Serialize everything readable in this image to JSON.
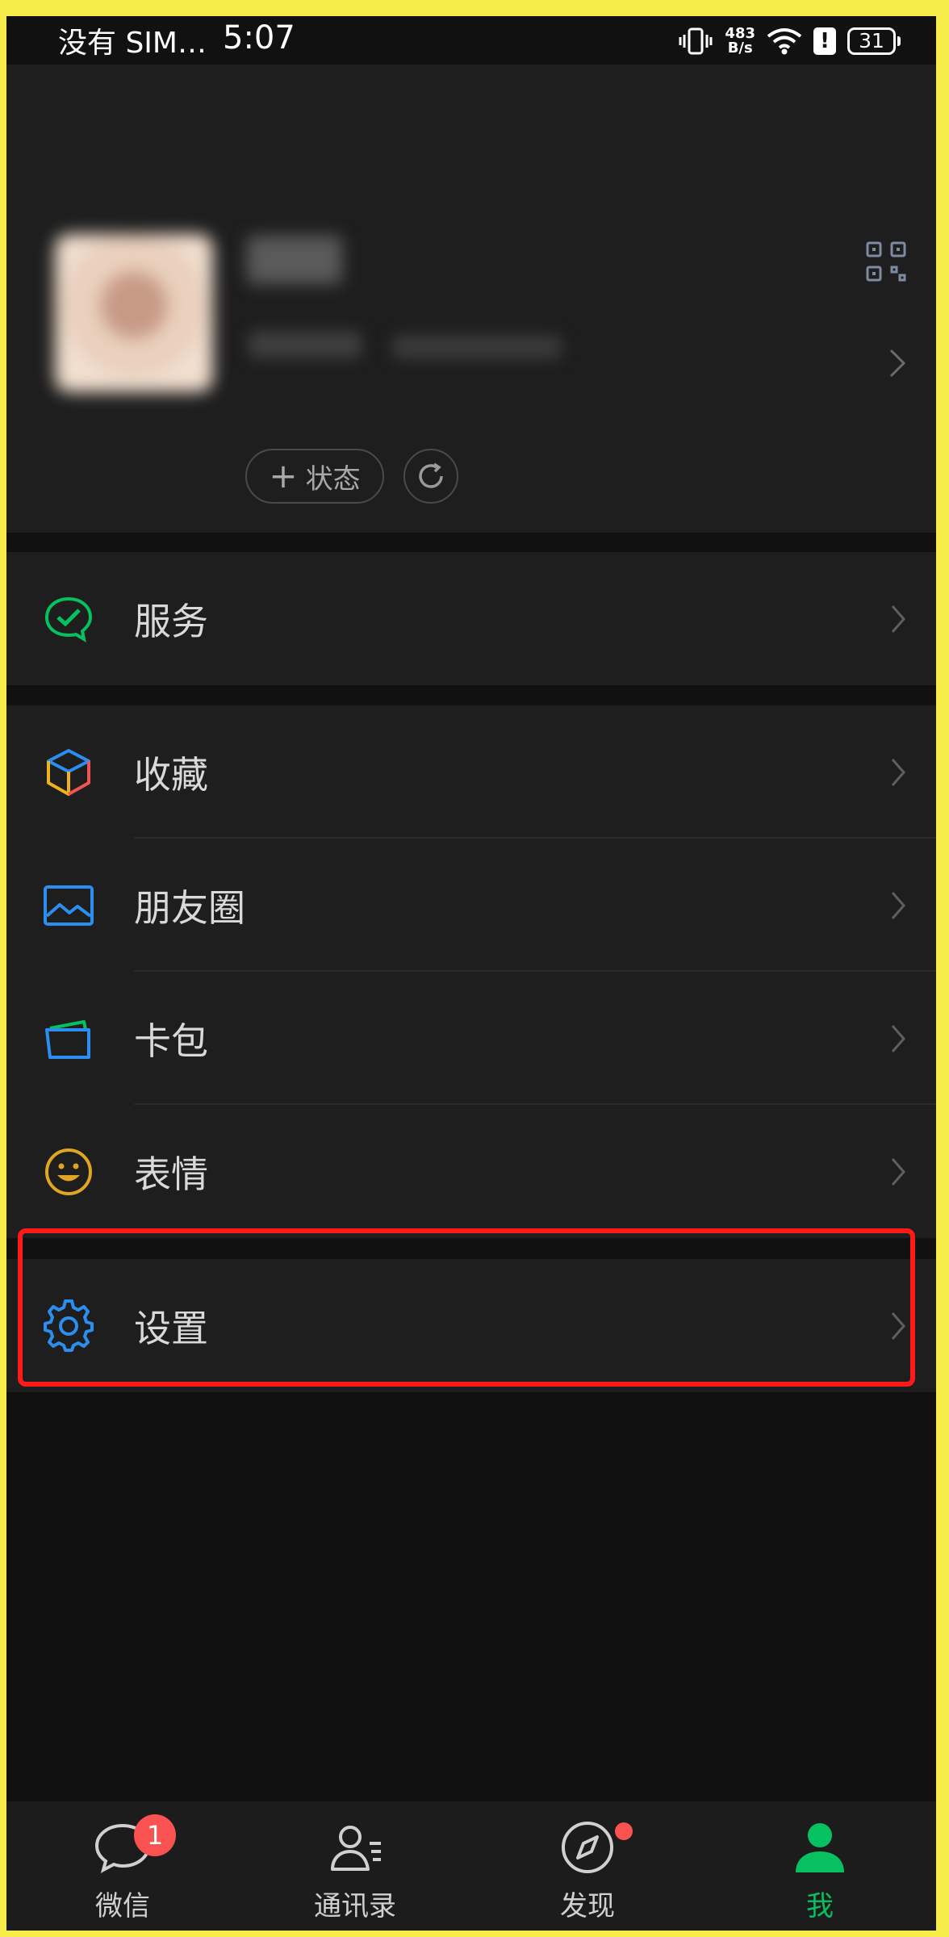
{
  "statusbar": {
    "carrier": "没有 SIM…",
    "time": "5:07",
    "speed_value": "483",
    "speed_unit": "B/s",
    "alert": "!",
    "battery": "31"
  },
  "profile": {
    "status_label": "状态",
    "status_plus": "+"
  },
  "menu": {
    "services": "服务",
    "favorites": "收藏",
    "moments": "朋友圈",
    "cards": "卡包",
    "stickers": "表情",
    "settings": "设置"
  },
  "tabs": [
    {
      "label": "微信",
      "badge": "1",
      "icon": "chat-bubble-icon"
    },
    {
      "label": "通讯录",
      "icon": "contacts-icon"
    },
    {
      "label": "发现",
      "icon": "compass-icon"
    },
    {
      "label": "我",
      "icon": "me-icon",
      "active": true
    }
  ],
  "colors": {
    "accent_green": "#07c160",
    "badge_red": "#fa5151",
    "highlight_red": "#ff1a1a",
    "frame_yellow": "#f6ec4a"
  }
}
